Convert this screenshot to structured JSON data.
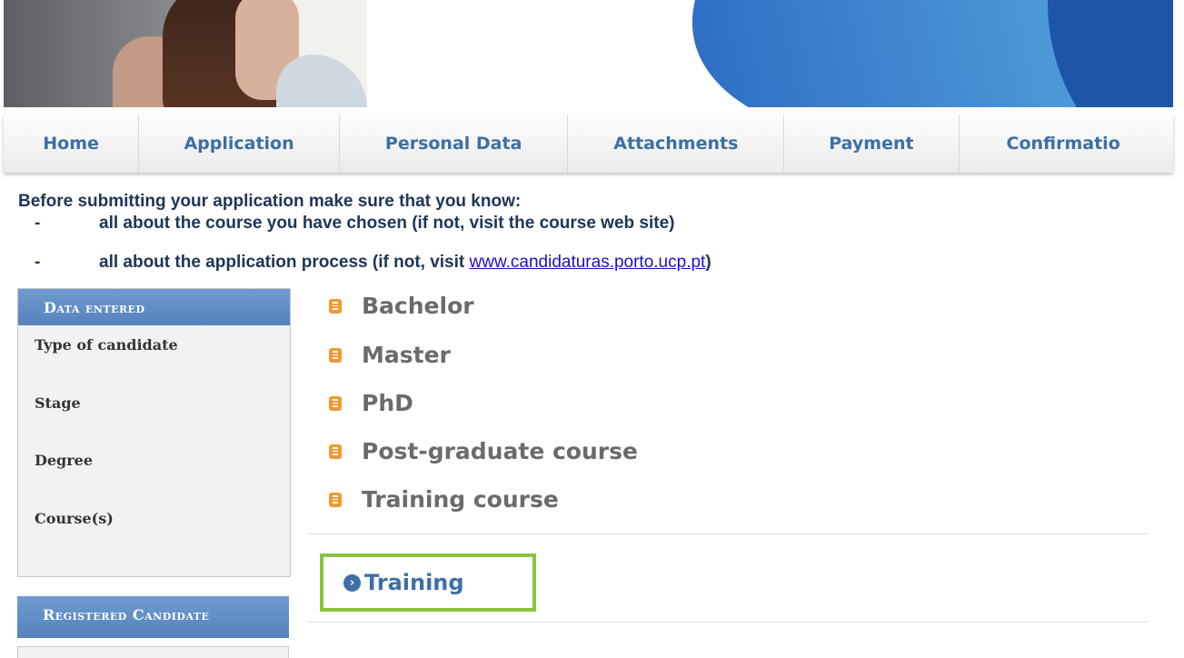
{
  "nav": {
    "items": [
      {
        "label": "Home"
      },
      {
        "label": "Application"
      },
      {
        "label": "Personal Data"
      },
      {
        "label": "Attachments"
      },
      {
        "label": "Payment"
      },
      {
        "label": "Confirmatio"
      }
    ]
  },
  "notice": {
    "heading": "Before submitting your application make sure that you know:",
    "dash": "-",
    "item1": "all about the course you have chosen (if not, visit the course web site)",
    "item2_prefix": "all about the application process (if not, visit ",
    "item2_link": "www.candidaturas.porto.ucp.pt",
    "item2_suffix": ")"
  },
  "sidebar": {
    "data_entered": {
      "title": "Data entered",
      "rows": [
        "Type of candidate",
        "Stage",
        "Degree",
        "Course(s)"
      ]
    },
    "registered": {
      "title": "Registered Candidate"
    }
  },
  "degrees": [
    "Bachelor",
    "Master",
    "PhD",
    "Post-graduate course",
    "Training course"
  ],
  "training": {
    "label": "Training",
    "icon": "chevron-right-circle-icon"
  },
  "colors": {
    "nav_text": "#3d6fa5",
    "bullet": "#f09a33",
    "highlight_border": "#8bc53f",
    "sidebar_header": "#6f9bd0"
  }
}
